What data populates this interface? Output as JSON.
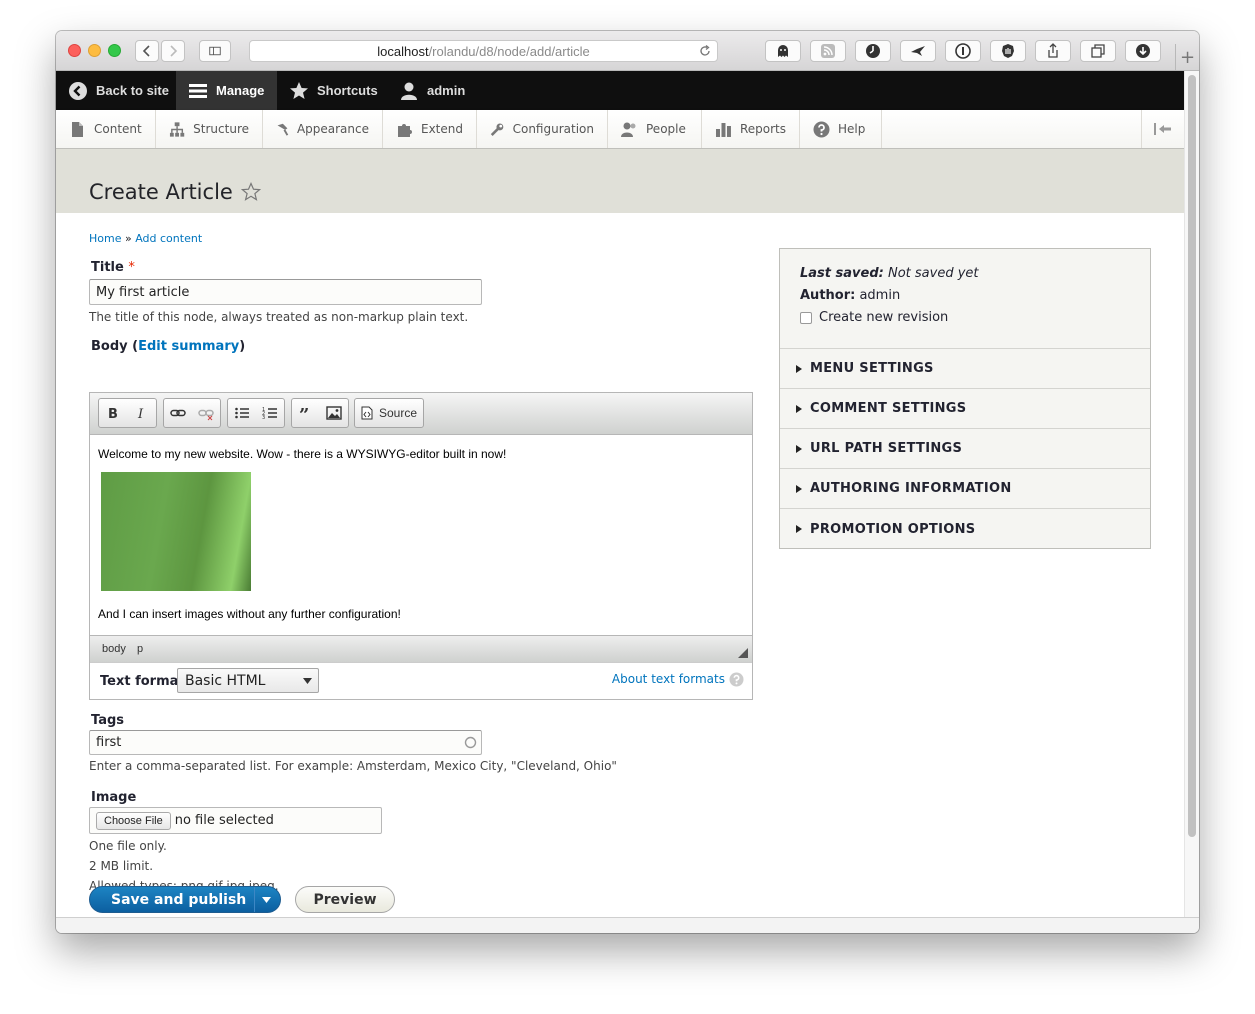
{
  "browser": {
    "url_host": "localhost",
    "url_path": "/rolandu/d8/node/add/article"
  },
  "toolbar": {
    "back": "Back to site",
    "manage": "Manage",
    "shortcuts": "Shortcuts",
    "user": "admin"
  },
  "tray": {
    "items": [
      "Content",
      "Structure",
      "Appearance",
      "Extend",
      "Configuration",
      "People",
      "Reports",
      "Help"
    ]
  },
  "page": {
    "title": "Create Article",
    "breadcrumb": [
      "Home",
      "Add content"
    ],
    "breadcrumb_sep": "»"
  },
  "form": {
    "title_label": "Title",
    "title_required": "*",
    "title_value": "My first article",
    "title_desc": "The title of this node, always treated as non-markup plain text.",
    "body_label": "Body (",
    "body_summary_link": "Edit summary",
    "body_label_close": ")",
    "editor": {
      "source_label": "Source",
      "paragraph1": "Welcome to my new website. Wow - there is a WYSIWYG-editor built in now!",
      "paragraph2": "And I can insert images without any further configuration!",
      "path": [
        "body",
        "p"
      ]
    },
    "text_format_label": "Text format",
    "text_format_value": "Basic HTML",
    "about_formats": "About text formats",
    "tags_label": "Tags",
    "tags_value": "first",
    "tags_desc": "Enter a comma-separated list. For example: Amsterdam, Mexico City, \"Cleveland, Ohio\"",
    "image_label": "Image",
    "choose_file": "Choose File",
    "no_file": "no file selected",
    "image_desc": [
      "One file only.",
      "2 MB limit.",
      "Allowed types: png gif jpg jpeg."
    ],
    "save": "Save and publish",
    "preview": "Preview"
  },
  "sidebar": {
    "last_saved_label": "Last saved:",
    "last_saved_value": "Not saved yet",
    "author_label": "Author:",
    "author_value": "admin",
    "revision_label": "Create new revision",
    "sections": [
      "MENU SETTINGS",
      "COMMENT SETTINGS",
      "URL PATH SETTINGS",
      "AUTHORING INFORMATION",
      "PROMOTION OPTIONS"
    ]
  },
  "colors": {
    "link": "#0074bd",
    "primary_button": "#0c5fa0",
    "toolbar_bg": "#0f0f0f",
    "page_head_bg": "#e0e0d8"
  }
}
